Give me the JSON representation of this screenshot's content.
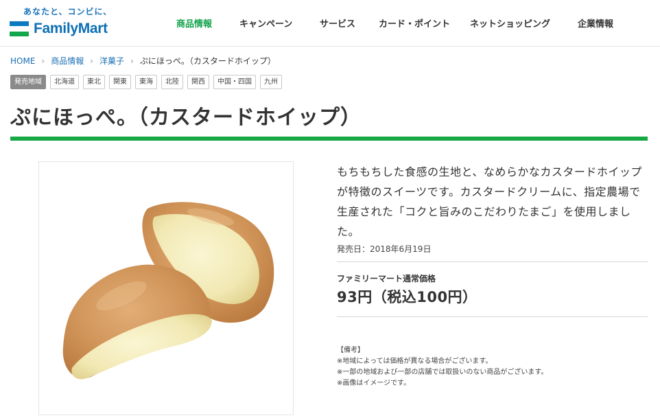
{
  "header": {
    "tagline": "あなたと、コンビに、",
    "logo_text": "FamilyMart",
    "nav": [
      {
        "label": "商品情報",
        "active": true
      },
      {
        "label": "キャンペーン",
        "active": false
      },
      {
        "label": "サービス",
        "active": false
      },
      {
        "label": "カード・ポイント",
        "active": false
      },
      {
        "label": "ネットショッピング",
        "active": false
      },
      {
        "label": "企業情報",
        "active": false
      }
    ]
  },
  "breadcrumb": {
    "items": [
      "HOME",
      "商品情報",
      "洋菓子"
    ],
    "current": "ぷにほっぺ。（カスタードホイップ）"
  },
  "regions": {
    "label": "発売地域",
    "tags": [
      "北海道",
      "東北",
      "関東",
      "東海",
      "北陸",
      "関西",
      "中国・四国",
      "九州"
    ]
  },
  "product": {
    "title": "ぷにほっぺ。（カスタードホイップ）",
    "description": "もちもちした食感の生地と、なめらかなカスタードホイップが特徴のスイーツです。カスタードクリームに、指定農場で生産された「コクと旨みのこだわりたまご」を使用しました。",
    "release_date": "発売日：2018年6月19日",
    "price_label": "ファミリーマート通常価格",
    "price": "93円（税込100円）",
    "notes": [
      "【備考】",
      "※地域によっては価格が異なる場合がございます。",
      "※一部の地域および一部の店舗では取扱いのない商品がございます。",
      "※画像はイメージです。"
    ]
  },
  "colors": {
    "brand_green": "#18a844",
    "brand_blue": "#0b6fb4",
    "link_blue": "#1a6fb3"
  }
}
